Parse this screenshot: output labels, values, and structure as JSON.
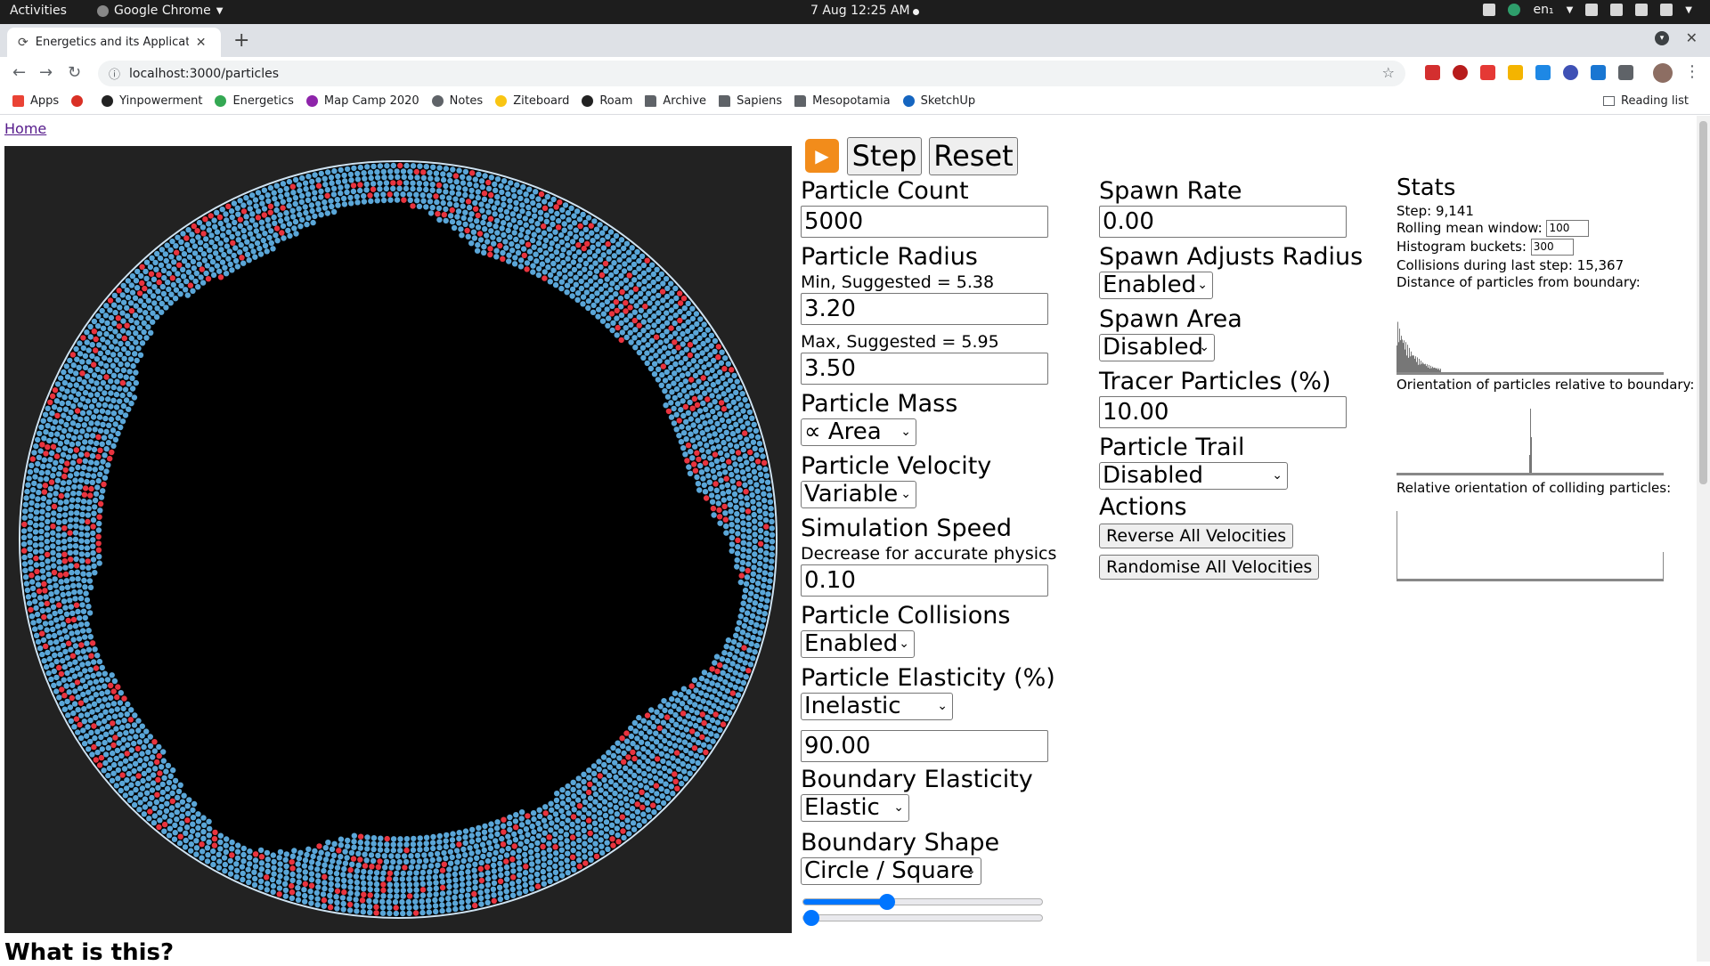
{
  "system_bar": {
    "activities": "Activities",
    "app_name": "Google Chrome",
    "clock": "7 Aug  12:25 AM",
    "language": "en₁"
  },
  "browser": {
    "tab_title": "Energetics and its Applicatio",
    "url": "localhost:3000/particles",
    "bookmarks": [
      {
        "label": "Apps",
        "icon": "apps-grid-icon",
        "color": "#ea4335"
      },
      {
        "label": "",
        "icon": "fx-icon",
        "color": "#d93025"
      },
      {
        "label": "Yinpowerment",
        "icon": "yinpowerment-icon",
        "color": "#222222"
      },
      {
        "label": "Energetics",
        "icon": "google-drive-icon",
        "color": "#34a853"
      },
      {
        "label": "Map Camp 2020",
        "icon": "mapcamp-icon",
        "color": "#8e24aa"
      },
      {
        "label": "Notes",
        "icon": "apple-icon",
        "color": "#5f6368"
      },
      {
        "label": "Ziteboard",
        "icon": "ziteboard-icon",
        "color": "#f9c513"
      },
      {
        "label": "Roam",
        "icon": "roam-icon",
        "color": "#222222"
      },
      {
        "label": "Archive",
        "icon": "folder-icon",
        "color": "#5f6368"
      },
      {
        "label": "Sapiens",
        "icon": "folder-icon",
        "color": "#5f6368"
      },
      {
        "label": "Mesopotamia",
        "icon": "folder-icon",
        "color": "#5f6368"
      },
      {
        "label": "SketchUp",
        "icon": "sketchup-icon",
        "color": "#1565c0"
      }
    ],
    "reading_list": "Reading list"
  },
  "page": {
    "home_link": "Home",
    "controls": {
      "step_label": "Step",
      "reset_label": "Reset",
      "particle_count": {
        "label": "Particle Count",
        "value": "5000"
      },
      "particle_radius": {
        "label": "Particle Radius",
        "min_label": "Min, Suggested = 5.38",
        "min_value": "3.20",
        "max_label": "Max, Suggested = 5.95",
        "max_value": "3.50"
      },
      "particle_mass": {
        "label": "Particle Mass",
        "value": "∝ Area"
      },
      "particle_velocity": {
        "label": "Particle Velocity",
        "value": "Variable"
      },
      "simulation_speed": {
        "label": "Simulation Speed",
        "hint": "Decrease for accurate physics",
        "value": "0.10"
      },
      "particle_collisions": {
        "label": "Particle Collisions",
        "value": "Enabled"
      },
      "particle_elasticity": {
        "label": "Particle Elasticity (%)",
        "mode": "Inelastic",
        "value": "90.00"
      },
      "boundary_elasticity": {
        "label": "Boundary Elasticity",
        "value": "Elastic"
      },
      "boundary_shape": {
        "label": "Boundary Shape",
        "value": "Circle / Square",
        "slider1": 0.35,
        "slider2": 0.0
      },
      "spawn_rate": {
        "label": "Spawn Rate",
        "value": "0.00"
      },
      "spawn_adjusts_radius": {
        "label": "Spawn Adjusts Radius",
        "value": "Enabled"
      },
      "spawn_area": {
        "label": "Spawn Area",
        "value": "Disabled"
      },
      "tracer_particles": {
        "label": "Tracer Particles (%)",
        "value": "10.00"
      },
      "particle_trail": {
        "label": "Particle Trail",
        "value": "Disabled"
      },
      "actions": {
        "label": "Actions",
        "reverse": "Reverse All Velocities",
        "randomise": "Randomise All Velocities"
      }
    },
    "stats": {
      "title": "Stats",
      "step": "Step: 9,141",
      "rolling_mean_label": "Rolling mean window:",
      "rolling_mean_value": "100",
      "histogram_buckets_label": "Histogram buckets:",
      "histogram_buckets_value": "300",
      "collisions": "Collisions during last step: 15,367",
      "distance_label": "Distance of particles from boundary:",
      "orientation_label": "Orientation of particles relative to boundary:",
      "relative_label": "Relative orientation of colliding particles:"
    },
    "what_is_this": "What is this?"
  },
  "colors": {
    "particle": "#5aa6d8",
    "tracer": "#e8343f",
    "simulation_bg": "#222222",
    "play_button": "#f28c1b"
  }
}
